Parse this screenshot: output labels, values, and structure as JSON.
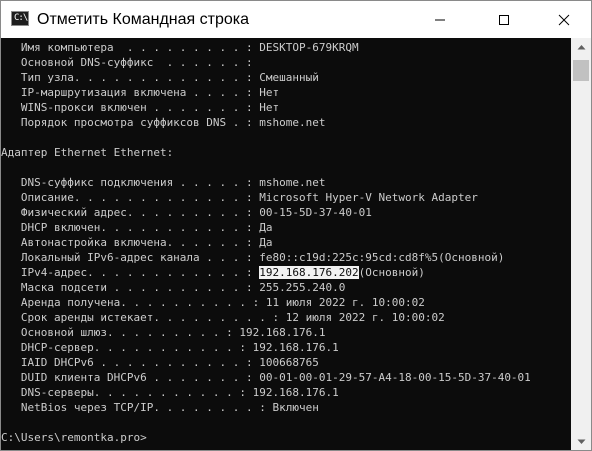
{
  "window": {
    "title": "Отметить Командная строка",
    "icon_label": "C:\\"
  },
  "icons": {
    "app": "command-prompt-icon",
    "minimize": "minimize-icon",
    "maximize": "maximize-icon",
    "close": "close-icon",
    "scroll_up": "scroll-up-arrow-icon",
    "scroll_down": "scroll-down-arrow-icon"
  },
  "console": {
    "lines": [
      "   Имя компьютера  . . . . . . . . . : DESKTOP-679KRQM",
      "   Основной DNS-суффикс  . . . . . . :",
      "   Тип узла. . . . . . . . . . . . . : Смешанный",
      "   IP-маршрутизация включена . . . . : Нет",
      "   WINS-прокси включен . . . . . . . : Нет",
      "   Порядок просмотра суффиксов DNS . : mshome.net",
      "",
      "Адаптер Ethernet Ethernet:",
      "",
      "   DNS-суффикс подключения . . . . . : mshome.net",
      "   Описание. . . . . . . . . . . . . : Microsoft Hyper-V Network Adapter",
      "   Физический адрес. . . . . . . . . : 00-15-5D-37-40-01",
      "   DHCP включен. . . . . . . . . . . : Да",
      "   Автонастройка включена. . . . . . : Да",
      "   Локальный IPv6-адрес канала . . . : fe80::c19d:225c:95cd:cd8f%5(Основной)",
      "__IPV4__",
      "   Маска подсети . . . . . . . . . . : 255.255.240.0",
      "   Аренда получена. . . . . . . . . . : 11 июля 2022 г. 10:00:02",
      "   Срок аренды истекает. . . . . . . . . : 12 июля 2022 г. 10:00:02",
      "   Основной шлюз. . . . . . . . . : 192.168.176.1",
      "   DHCP-сервер. . . . . . . . . . . : 192.168.176.1",
      "   IAID DHCPv6 . . . . . . . . . . . : 100668765",
      "   DUID клиента DHCPv6 . . . . . . . : 00-01-00-01-29-57-A4-18-00-15-5D-37-40-01",
      "   DNS-серверы. . . . . . . . . . . : 192.168.176.1",
      "   NetBios через TCP/IP. . . . . . . . : Включен",
      "",
      "C:\\Users\\remontka.pro>"
    ],
    "ipv4": {
      "prefix": "   IPv4-адрес. . . . . . . . . . . . : ",
      "selected": "192.168.176.202",
      "suffix": "(Основной)"
    }
  },
  "colors": {
    "console_bg": "#0c0c0c",
    "console_text": "#cccccc",
    "selection_bg": "#f2f2f2",
    "selection_text": "#0c0c0c"
  }
}
